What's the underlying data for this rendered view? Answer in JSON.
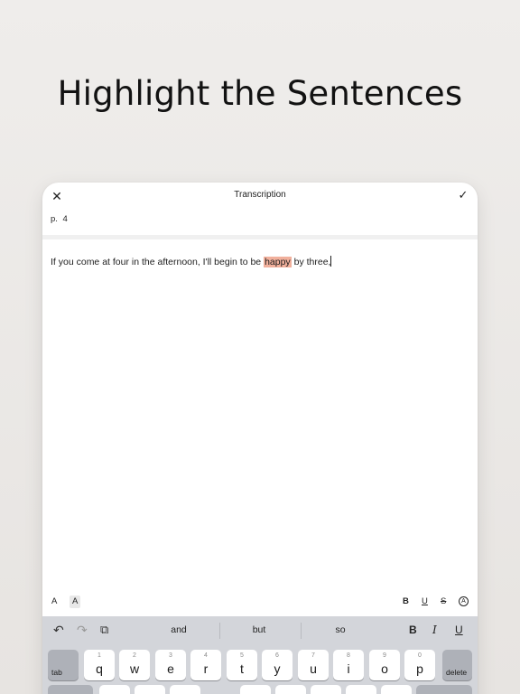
{
  "headline": "Highlight the Sentences",
  "app": {
    "title": "Transcription",
    "close_glyph": "✕",
    "done_glyph": "✓",
    "page_label": "p. 4"
  },
  "editor": {
    "text_before": "If you come at four in the afternoon, I'll begin to be ",
    "highlighted": "happy",
    "text_after": " by three,",
    "highlight_color": "#f1b09c"
  },
  "format_bar": {
    "font_small": "A",
    "font_large": "A",
    "bold": "B",
    "underline": "U",
    "strike": "S",
    "circle": "A"
  },
  "keyboard": {
    "undo_glyph": "↶",
    "redo_glyph": "↷",
    "paste_glyph": "⧉",
    "suggestions": [
      "and",
      "but",
      "so"
    ],
    "bold": "B",
    "italic": "I",
    "underline": "U",
    "tab_label": "tab",
    "delete_label": "delete",
    "keys": [
      {
        "num": "1",
        "ch": "q"
      },
      {
        "num": "2",
        "ch": "w"
      },
      {
        "num": "3",
        "ch": "e"
      },
      {
        "num": "4",
        "ch": "r"
      },
      {
        "num": "5",
        "ch": "t"
      },
      {
        "num": "6",
        "ch": "y"
      },
      {
        "num": "7",
        "ch": "u"
      },
      {
        "num": "8",
        "ch": "i"
      },
      {
        "num": "9",
        "ch": "o"
      },
      {
        "num": "0",
        "ch": "p"
      }
    ]
  }
}
